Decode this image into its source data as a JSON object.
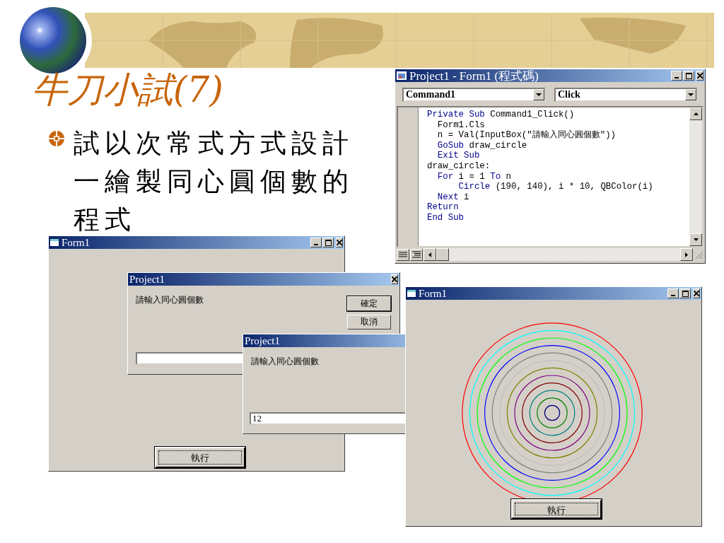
{
  "slide": {
    "title": "牛刀小試(7)",
    "bullets": [
      "試以次常式方式設計一繪製同心圓個數的程式"
    ]
  },
  "code_window": {
    "title": "Project1 - Form1 (程式碼)",
    "object_box": "Command1",
    "procedure_box": "Click",
    "lines": [
      {
        "parts": [
          {
            "text": "Private Sub",
            "keyword": true
          },
          {
            "text": " Command1_Click()",
            "keyword": false
          }
        ]
      },
      {
        "parts": [
          {
            "text": "  Form1.Cls",
            "keyword": false
          }
        ]
      },
      {
        "parts": [
          {
            "text": "  n = Val(InputBox(\"請輸入同心圓個數\"))",
            "keyword": false
          }
        ]
      },
      {
        "parts": [
          {
            "text": "  GoSub",
            "keyword": true
          },
          {
            "text": " draw_circle",
            "keyword": false
          }
        ]
      },
      {
        "parts": [
          {
            "text": "  Exit Sub",
            "keyword": true
          }
        ]
      },
      {
        "parts": [
          {
            "text": "draw_circle:",
            "keyword": false
          }
        ]
      },
      {
        "parts": [
          {
            "text": "  For",
            "keyword": true
          },
          {
            "text": " i = 1 ",
            "keyword": false
          },
          {
            "text": "To",
            "keyword": true
          },
          {
            "text": " n",
            "keyword": false
          }
        ]
      },
      {
        "parts": [
          {
            "text": "      Circle",
            "keyword": true
          },
          {
            "text": " (190, 140), i * 10, QBColor(i)",
            "keyword": false
          }
        ]
      },
      {
        "parts": [
          {
            "text": "  Next",
            "keyword": true
          },
          {
            "text": " i",
            "keyword": false
          }
        ]
      },
      {
        "parts": [
          {
            "text": "Return",
            "keyword": true
          }
        ]
      },
      {
        "parts": [
          {
            "text": "End Sub",
            "keyword": true
          }
        ]
      }
    ]
  },
  "form_left": {
    "title": "Form1",
    "button": "執行"
  },
  "input_dialogs": [
    {
      "title": "Project1",
      "prompt": "請輸入同心圓個數",
      "ok": "確定",
      "cancel": "取消"
    },
    {
      "title": "Project1",
      "prompt": "請輸入同心圓個數",
      "value": "12"
    }
  ],
  "form_right": {
    "title": "Form1",
    "button": "執行"
  }
}
